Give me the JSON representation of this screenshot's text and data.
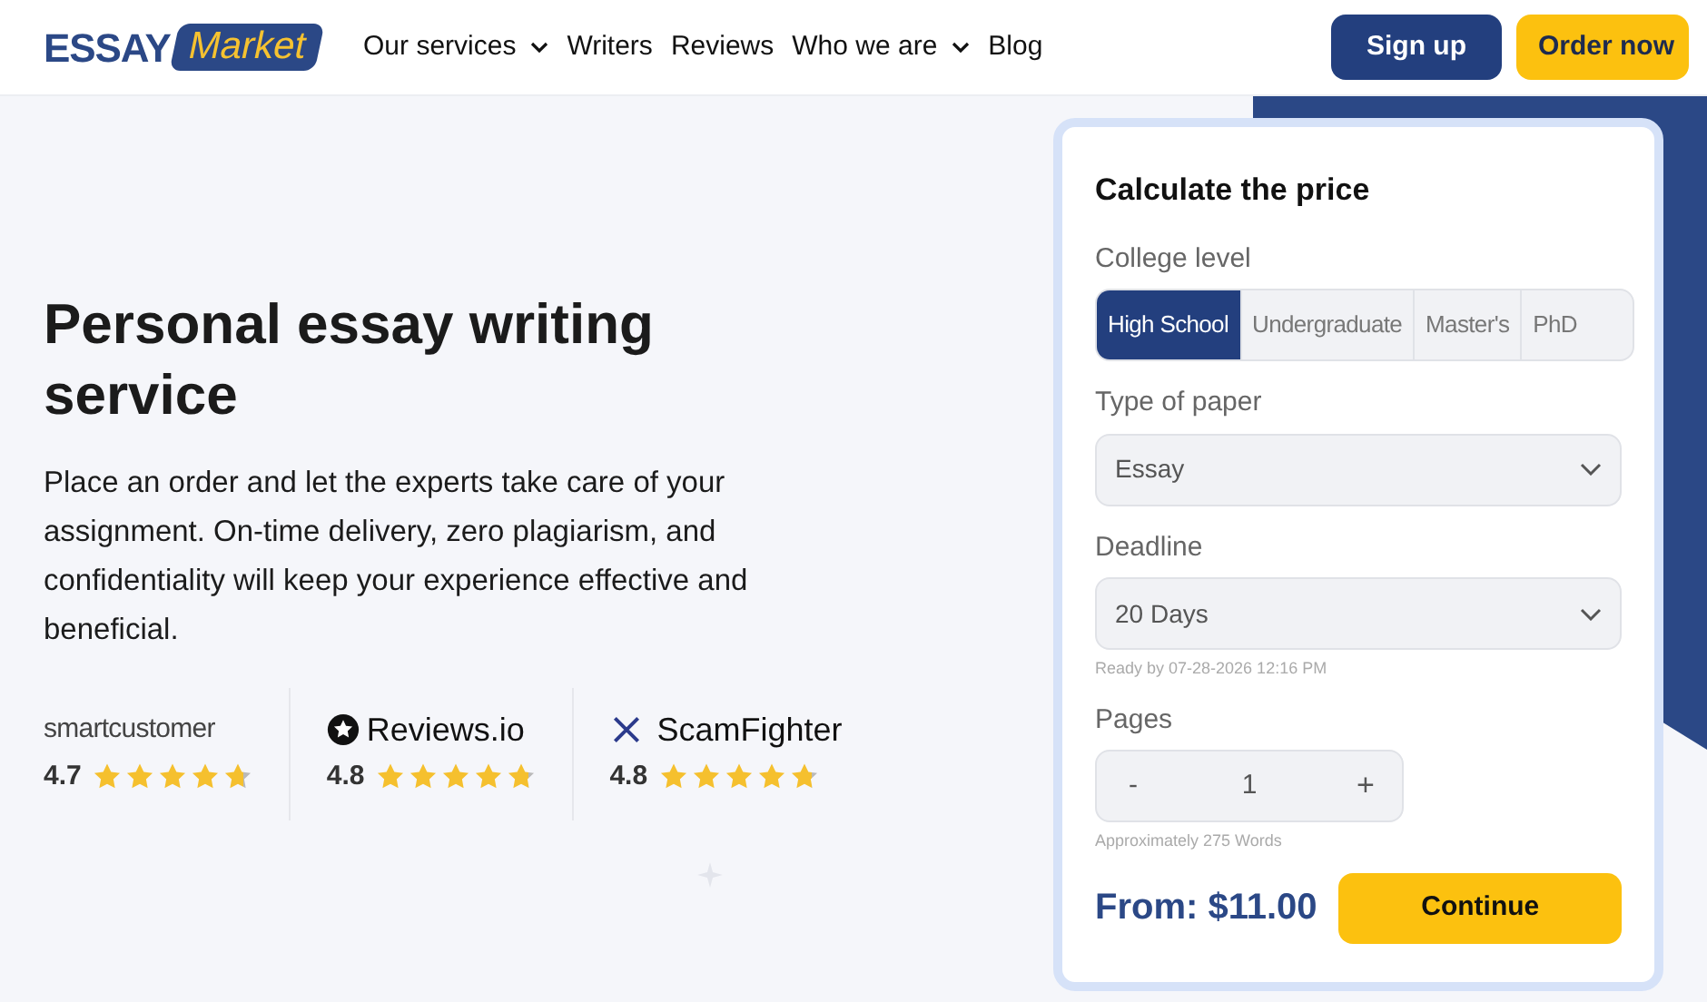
{
  "logo": {
    "first": "ESSAY",
    "second": "Market"
  },
  "nav": [
    {
      "label": "Our services",
      "dropdown": true
    },
    {
      "label": "Writers",
      "dropdown": false
    },
    {
      "label": "Reviews",
      "dropdown": false
    },
    {
      "label": "Who we are",
      "dropdown": true
    },
    {
      "label": "Blog",
      "dropdown": false
    }
  ],
  "header_buttons": [
    {
      "label": "Sign up",
      "kind": "secondary"
    },
    {
      "label": "Order now",
      "kind": "primary"
    }
  ],
  "hero": {
    "title": "Personal essay writing service",
    "text": "Place an order and let the experts take care of your assignment. On-time delivery, zero plagiarism, and confidentiality will keep your experience effective and beneficial."
  },
  "ratings": [
    {
      "site": "smartcustomer",
      "kind": "smartcustomer",
      "score": "4.7",
      "stars": 4.7
    },
    {
      "site": "Reviews.io",
      "kind": "reviewsio",
      "score": "4.8",
      "stars": 4.8
    },
    {
      "site": "ScamFighter",
      "kind": "scamfighter",
      "score": "4.8",
      "stars": 4.8
    }
  ],
  "calculator": {
    "title": "Calculate the price",
    "level_label": "College level",
    "levels": [
      {
        "label": "High School",
        "selected": true
      },
      {
        "label": "Undergraduate",
        "selected": false
      },
      {
        "label": "Master's",
        "selected": false
      },
      {
        "label": "PhD",
        "selected": false
      }
    ],
    "paper_label": "Type of paper",
    "paper_value": "Essay",
    "deadline_label": "Deadline",
    "deadline_value": "20 Days",
    "deadline_note": "Ready by 07-28-2026 12:16 PM",
    "pages_label": "Pages",
    "minus": "-",
    "pages_value": "1",
    "plus": "+",
    "pages_note": "Approximately 275 Words",
    "price": "From: $11.00",
    "continue": "Continue"
  }
}
